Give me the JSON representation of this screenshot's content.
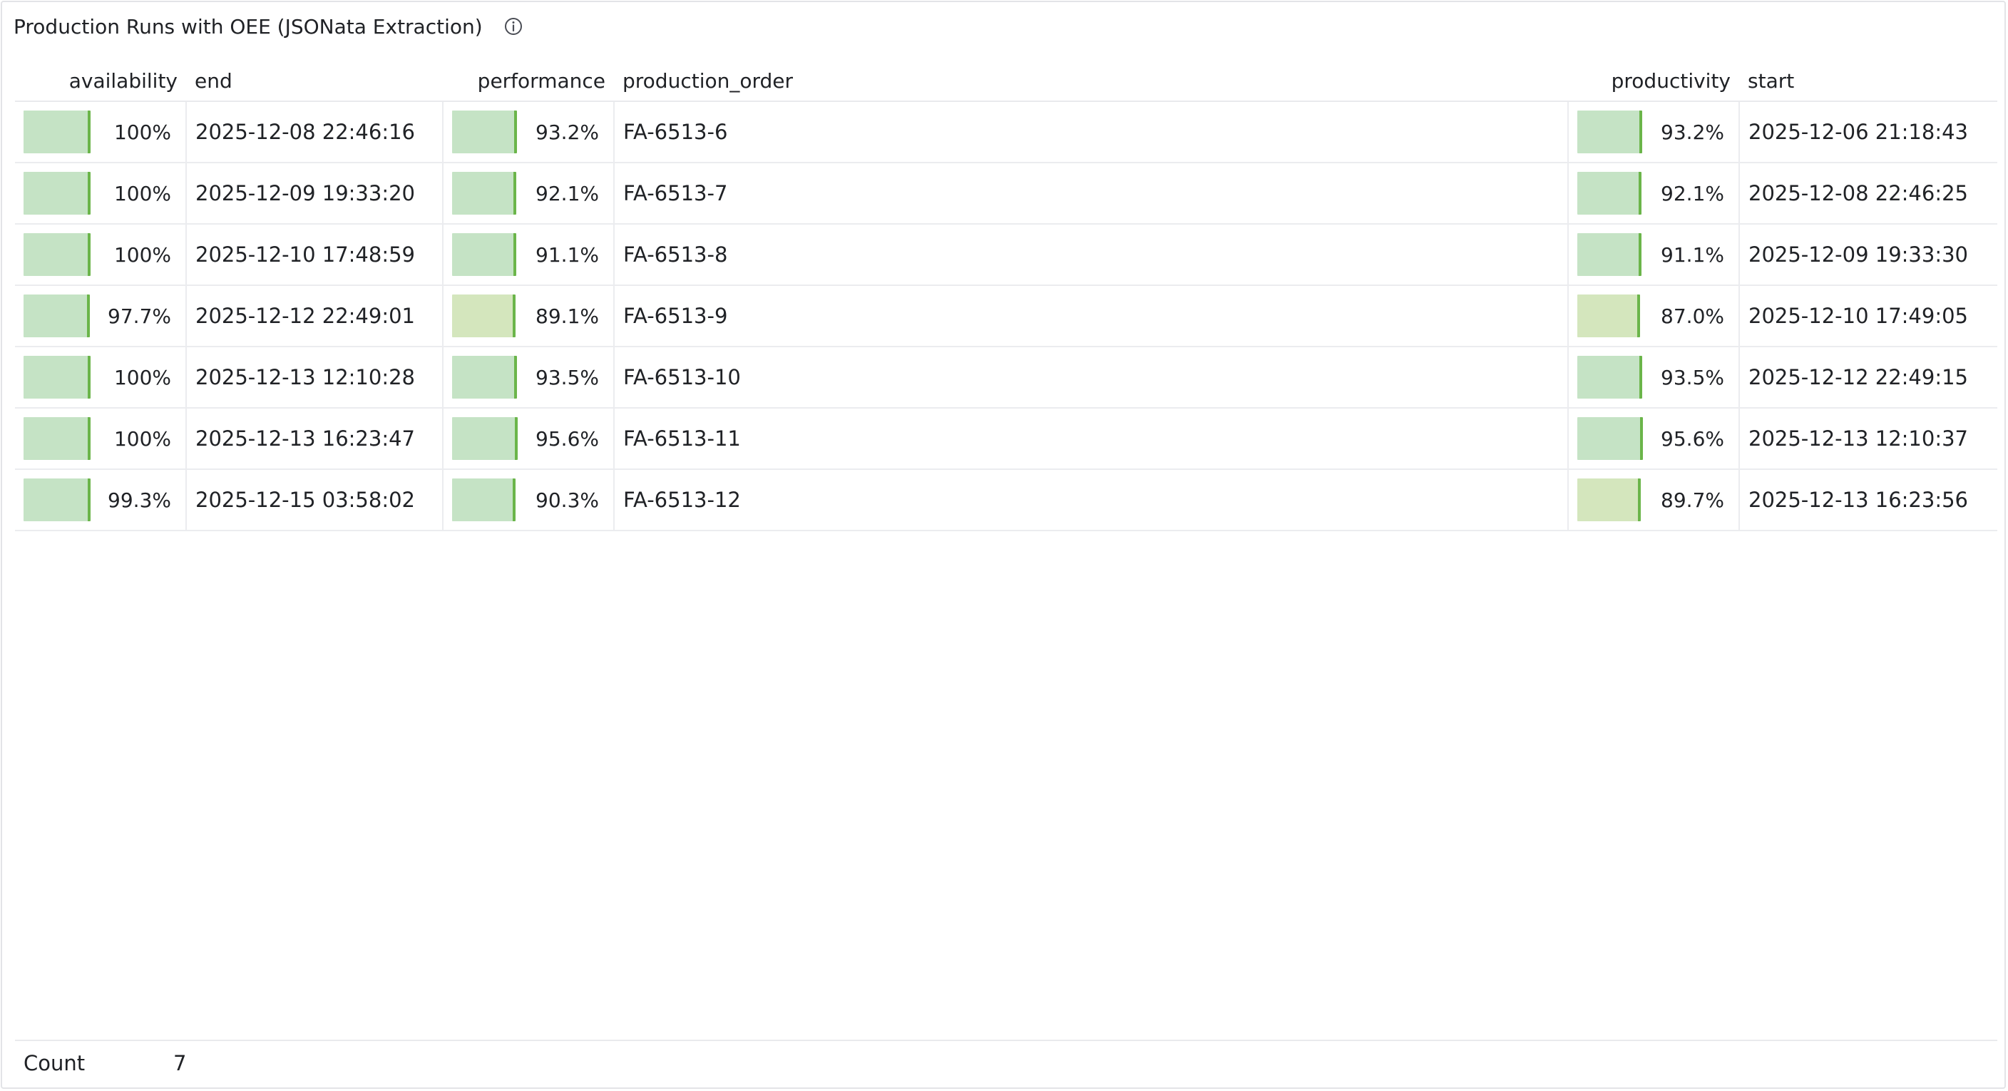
{
  "panel": {
    "title": "Production Runs with OEE (JSONata Extraction)",
    "info_icon": "info-circle-icon"
  },
  "table": {
    "columns": [
      "availability",
      "end",
      "performance",
      "production_order",
      "productivity",
      "start"
    ],
    "rows": [
      {
        "availability": "100%",
        "availability_level": 1.0,
        "end": "2025-12-08 22:46:16",
        "performance": "93.2%",
        "performance_level": 0.932,
        "production_order": "FA-6513-6",
        "productivity": "93.2%",
        "productivity_level": 0.932,
        "start": "2025-12-06 21:18:43"
      },
      {
        "availability": "100%",
        "availability_level": 1.0,
        "end": "2025-12-09 19:33:20",
        "performance": "92.1%",
        "performance_level": 0.921,
        "production_order": "FA-6513-7",
        "productivity": "92.1%",
        "productivity_level": 0.921,
        "start": "2025-12-08 22:46:25"
      },
      {
        "availability": "100%",
        "availability_level": 1.0,
        "end": "2025-12-10 17:48:59",
        "performance": "91.1%",
        "performance_level": 0.911,
        "production_order": "FA-6513-8",
        "productivity": "91.1%",
        "productivity_level": 0.911,
        "start": "2025-12-09 19:33:30"
      },
      {
        "availability": "97.7%",
        "availability_level": 0.977,
        "end": "2025-12-12 22:49:01",
        "performance": "89.1%",
        "performance_level": 0.891,
        "production_order": "FA-6513-9",
        "productivity": "87.0%",
        "productivity_level": 0.87,
        "start": "2025-12-10 17:49:05"
      },
      {
        "availability": "100%",
        "availability_level": 1.0,
        "end": "2025-12-13 12:10:28",
        "performance": "93.5%",
        "performance_level": 0.935,
        "production_order": "FA-6513-10",
        "productivity": "93.5%",
        "productivity_level": 0.935,
        "start": "2025-12-12 22:49:15"
      },
      {
        "availability": "100%",
        "availability_level": 1.0,
        "end": "2025-12-13 16:23:47",
        "performance": "95.6%",
        "performance_level": 0.956,
        "production_order": "FA-6513-11",
        "productivity": "95.6%",
        "productivity_level": 0.956,
        "start": "2025-12-13 12:10:37"
      },
      {
        "availability": "99.3%",
        "availability_level": 0.993,
        "end": "2025-12-15 03:58:02",
        "performance": "90.3%",
        "performance_level": 0.903,
        "production_order": "FA-6513-12",
        "productivity": "89.7%",
        "productivity_level": 0.897,
        "start": "2025-12-13 16:23:56"
      }
    ]
  },
  "footer": {
    "label": "Count",
    "value": "7"
  },
  "colors": {
    "gauge_fill": "#c5e3c5",
    "gauge_fill_low": "#d4e6bd",
    "gauge_edge": "#6bb54a",
    "border": "#e3e4e7"
  }
}
